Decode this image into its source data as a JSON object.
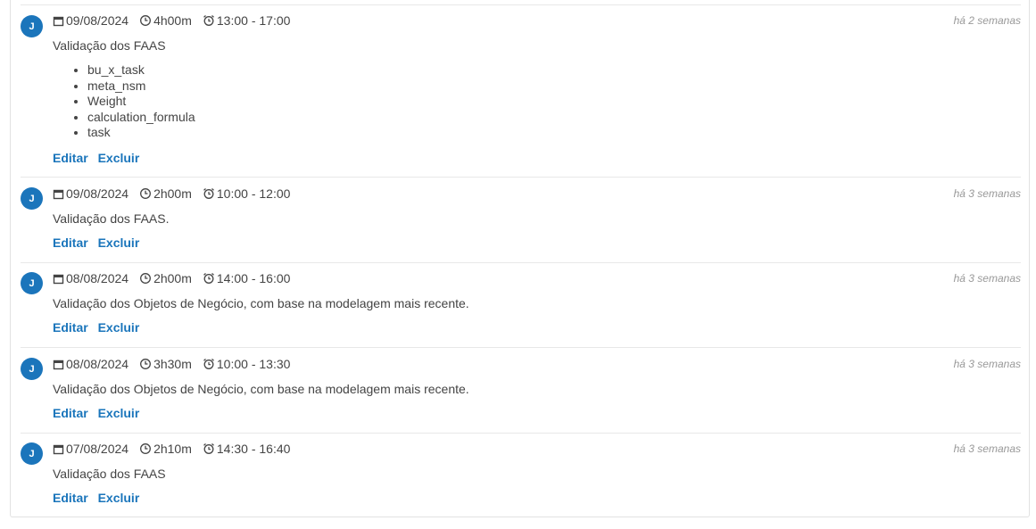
{
  "entries": [
    {
      "avatar": "J",
      "date": "09/08/2024",
      "duration": "4h00m",
      "time_range": "13:00 - 17:00",
      "ago": "há 2 semanas",
      "description": "Validação dos FAAS",
      "items": [
        "bu_x_task",
        "meta_nsm",
        "Weight",
        "calculation_formula",
        "task"
      ],
      "edit_label": "Editar",
      "delete_label": "Excluir"
    },
    {
      "avatar": "J",
      "date": "09/08/2024",
      "duration": "2h00m",
      "time_range": "10:00 - 12:00",
      "ago": "há 3 semanas",
      "description": "Validação dos FAAS.",
      "items": [],
      "edit_label": "Editar",
      "delete_label": "Excluir"
    },
    {
      "avatar": "J",
      "date": "08/08/2024",
      "duration": "2h00m",
      "time_range": "14:00 - 16:00",
      "ago": "há 3 semanas",
      "description": "Validação dos Objetos de Negócio, com base na modelagem mais recente.",
      "items": [],
      "edit_label": "Editar",
      "delete_label": "Excluir"
    },
    {
      "avatar": "J",
      "date": "08/08/2024",
      "duration": "3h30m",
      "time_range": "10:00 - 13:30",
      "ago": "há 3 semanas",
      "description": "Validação dos Objetos de Negócio, com base na modelagem mais recente.",
      "items": [],
      "edit_label": "Editar",
      "delete_label": "Excluir"
    },
    {
      "avatar": "J",
      "date": "07/08/2024",
      "duration": "2h10m",
      "time_range": "14:30 - 16:40",
      "ago": "há 3 semanas",
      "description": "Validação dos FAAS",
      "items": [],
      "edit_label": "Editar",
      "delete_label": "Excluir"
    }
  ]
}
